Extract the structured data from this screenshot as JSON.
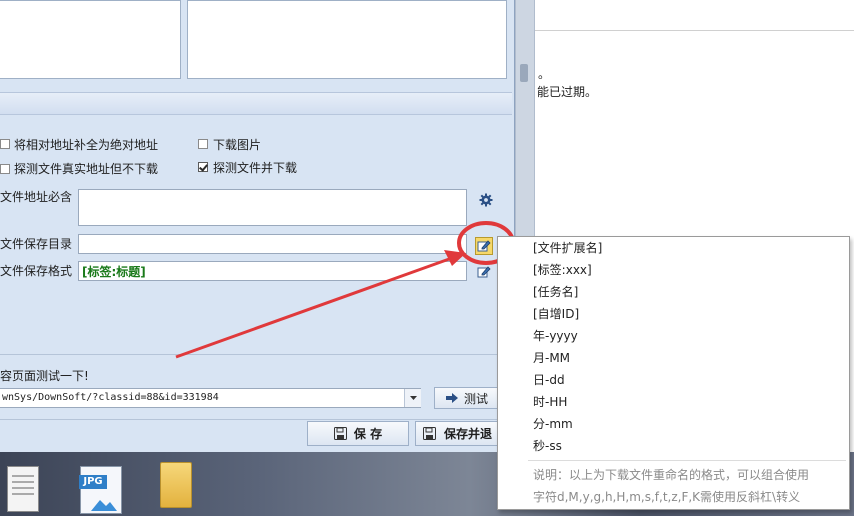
{
  "right_panel": {
    "line1": "。",
    "line2": "能已过期。"
  },
  "options": {
    "complete_url": "将相对地址补全为绝对地址",
    "download_images": "下载图片",
    "probe_no_download": "探测文件真实地址但不下载",
    "probe_and_download": "探测文件并下载",
    "probe_and_download_checked": true,
    "complete_url_checked": false,
    "download_images_checked": false,
    "probe_no_download_checked": false
  },
  "form": {
    "url_must_contain_label": "文件地址必含",
    "url_must_contain_value": "",
    "save_dir_label": "文件保存目录",
    "save_dir_value": "",
    "save_format_label": "文件保存格式",
    "save_format_value": "[标签:标题]"
  },
  "test": {
    "hint": "容页面测试一下!",
    "url_value": "wnSys/DownSoft/?classid=88&id=331984",
    "test_button": "测试"
  },
  "buttons": {
    "save": "保 存",
    "save_exit": "保存并退"
  },
  "desktop": {
    "jpg_label": "JPG"
  },
  "menu": {
    "items": [
      "[文件扩展名]",
      "[标签:xxx]",
      "[任务名]",
      "[自增ID]",
      "年-yyyy",
      "月-MM",
      "日-dd",
      "时-HH",
      "分-mm",
      "秒-ss"
    ],
    "note1": "说明：以上为下载文件重命名的格式，可以组合使用",
    "note2": "字符d,M,y,g,h,H,m,s,f,t,z,F,K需使用反斜杠\\转义"
  },
  "colors": {
    "annotation": "#e0393b",
    "format_text": "#1a7a1a",
    "dialog_bg": "#d8e4f3"
  }
}
